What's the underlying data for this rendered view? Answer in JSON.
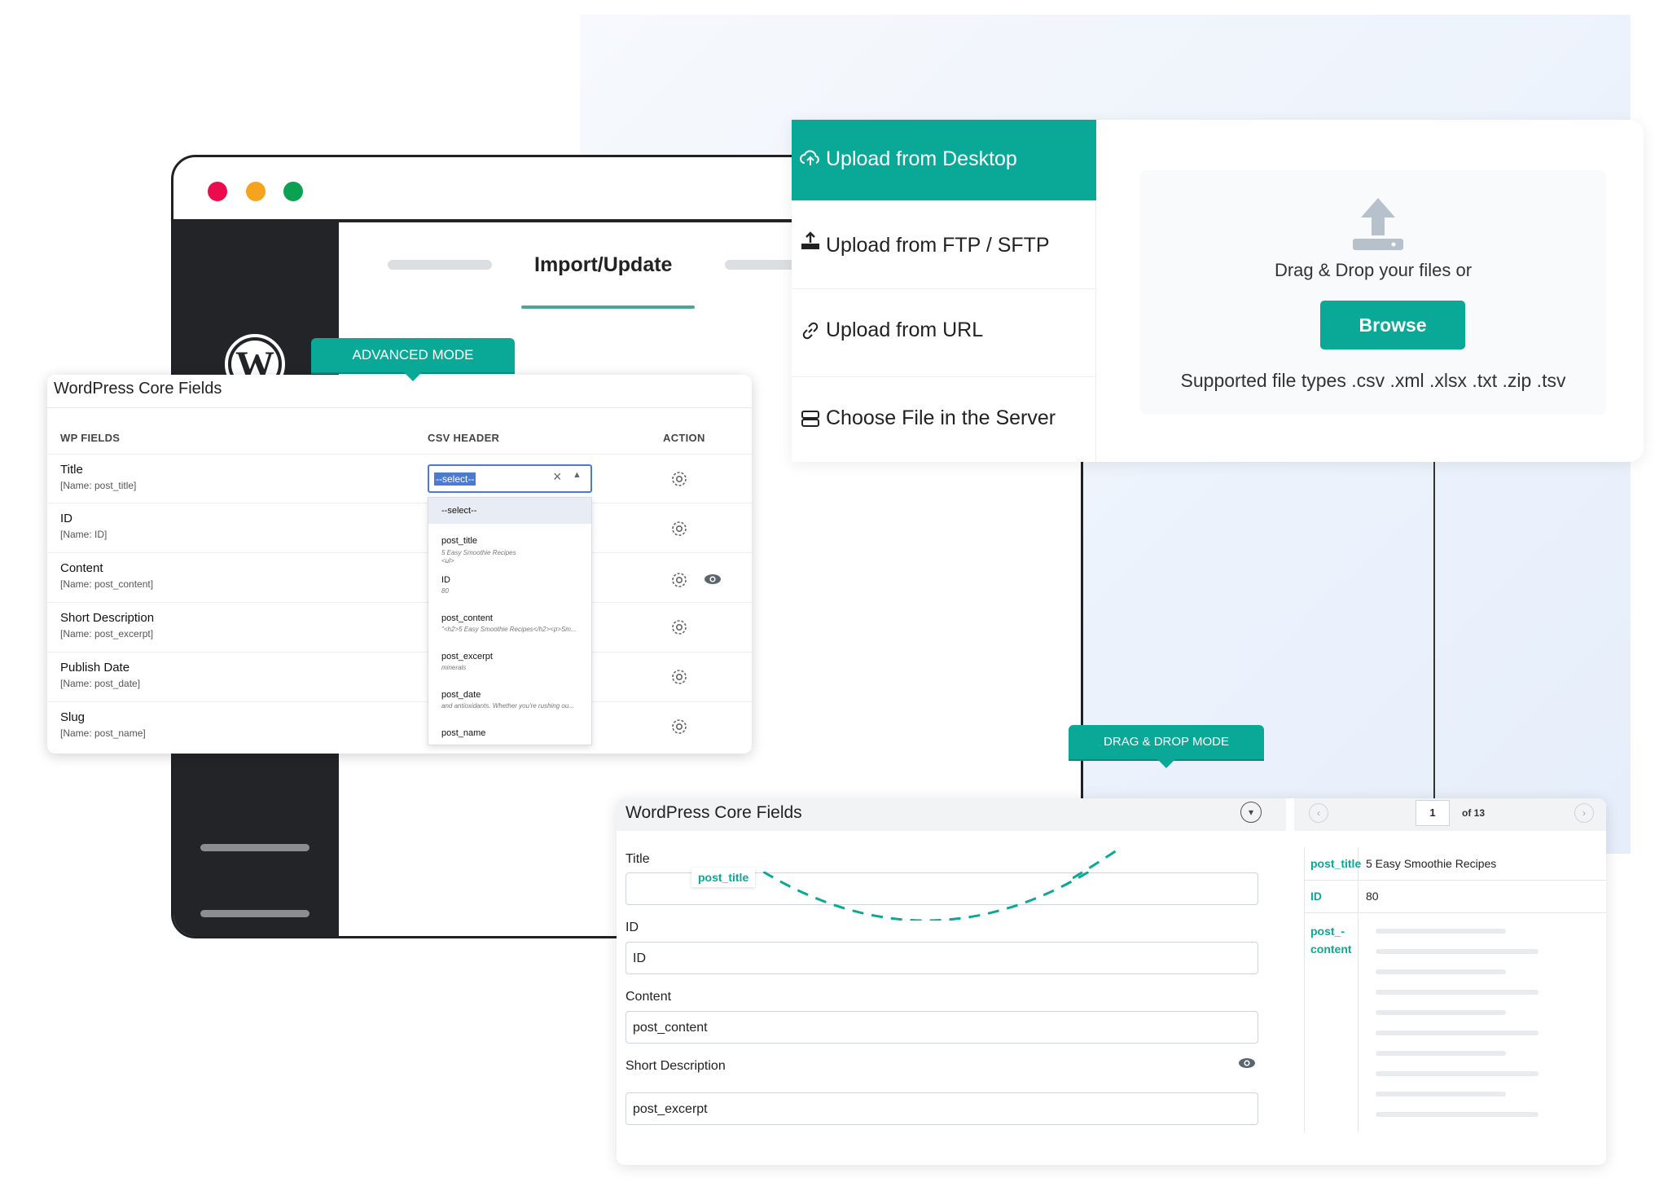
{
  "colors": {
    "accent": "#0aa896",
    "dark": "#222427",
    "close": "#ea0d4e",
    "minimize": "#f6a41e",
    "maximize": "#0ba152"
  },
  "browser": {
    "tab_title": "Import/Update"
  },
  "advanced": {
    "badge": "ADVANCED MODE",
    "title": "WordPress Core Fields",
    "col_wp": "WP FIELDS",
    "col_csv": "CSV HEADER",
    "col_action": "ACTION",
    "rows": [
      {
        "name": "Title",
        "sub": "[Name: post_title]"
      },
      {
        "name": "ID",
        "sub": "[Name: ID]"
      },
      {
        "name": "Content",
        "sub": "[Name: post_content]"
      },
      {
        "name": "Short Description",
        "sub": "[Name: post_excerpt]"
      },
      {
        "name": "Publish Date",
        "sub": "[Name: post_date]"
      },
      {
        "name": "Slug",
        "sub": "[Name: post_name]"
      }
    ],
    "select_value": "--select--",
    "dropdown": [
      {
        "label": "--select--",
        "preview": ""
      },
      {
        "label": "post_title",
        "preview": "5 Easy Smoothie Recipes",
        "preview2": "<ul>"
      },
      {
        "label": "ID",
        "preview": "80"
      },
      {
        "label": "post_content",
        "preview": "\"<h2>5 Easy Smoothie Recipes</h2><p>Sm..."
      },
      {
        "label": "post_excerpt",
        "preview": "minerals"
      },
      {
        "label": "post_date",
        "preview": "and antioxidants. Whether you're rushing ou..."
      },
      {
        "label": "post_name",
        "preview": ""
      }
    ]
  },
  "upload": {
    "items": [
      "Upload from Desktop",
      "Upload from FTP / SFTP",
      "Upload from URL",
      "Choose File in the Server"
    ],
    "drag_text": "Drag & Drop your files or",
    "browse": "Browse",
    "supported": "Supported file types .csv .xml .xlsx .txt .zip .tsv"
  },
  "dnd": {
    "badge": "DRAG & DROP MODE",
    "title": "WordPress Core Fields",
    "chip": "post_title",
    "fields": [
      {
        "label": "Title",
        "value": ""
      },
      {
        "label": "ID",
        "value": "ID"
      },
      {
        "label": "Content",
        "value": "post_content"
      },
      {
        "label": "Short Description",
        "value": "post_excerpt"
      }
    ],
    "page": "1",
    "of": "of 13",
    "pairs": [
      {
        "key": "post_title",
        "value": "5 Easy Smoothie Recipes"
      },
      {
        "key": "ID",
        "value": "80"
      },
      {
        "key": "post_-\ncontent",
        "value": ""
      }
    ]
  }
}
